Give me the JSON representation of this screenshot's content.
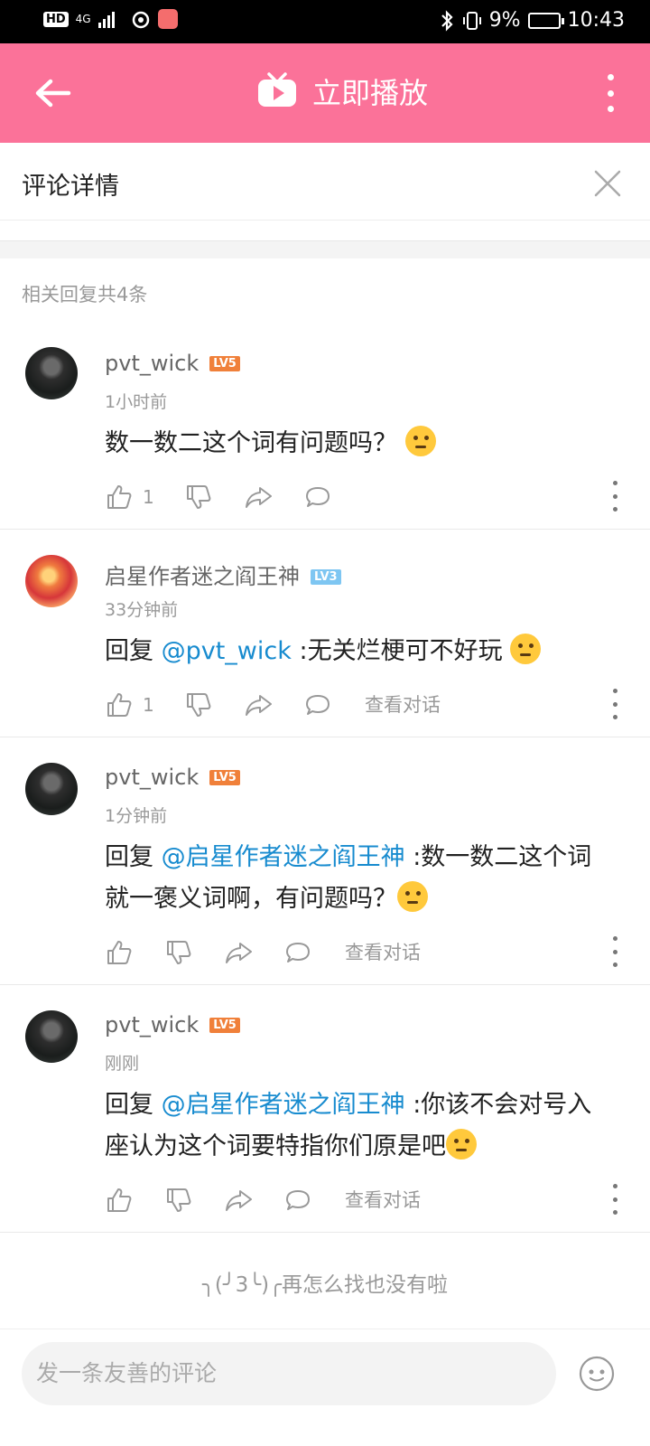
{
  "status_bar": {
    "hd": "HD",
    "network": "4G",
    "battery_pct": "9%",
    "time": "10:43"
  },
  "topbar": {
    "title": "立即播放"
  },
  "detail": {
    "title": "评论详情"
  },
  "reply_count": "相关回复共4条",
  "comments": [
    {
      "user": "pvt_wick",
      "level": "LV5",
      "time": "1小时前",
      "text": "数一数二这个词有问题吗？",
      "likes": "1",
      "view_conversation": ""
    },
    {
      "user": "启星作者迷之阎王神",
      "level": "LV3",
      "time": "33分钟前",
      "reply_prefix": "回复",
      "mention": "@pvt_wick",
      "text": ":无关烂梗可不好玩",
      "likes": "1",
      "view_conversation": "查看对话"
    },
    {
      "user": "pvt_wick",
      "level": "LV5",
      "time": "1分钟前",
      "reply_prefix": "回复",
      "mention": "@启星作者迷之阎王神",
      "text": ":数一数二这个词就一褒义词啊，有问题吗？",
      "likes": "",
      "view_conversation": "查看对话"
    },
    {
      "user": "pvt_wick",
      "level": "LV5",
      "time": "刚刚",
      "reply_prefix": "回复",
      "mention": "@启星作者迷之阎王神",
      "text": ":你该不会对号入座认为这个词要特指你们原是吧",
      "likes": "",
      "view_conversation": "查看对话"
    }
  ],
  "end_text": "╮(╯3╰)╭再怎么找也没有啦",
  "composer": {
    "placeholder": "发一条友善的评论"
  },
  "colors": {
    "accent_pink": "#fb7299",
    "mention_blue": "#178bcf",
    "lv5": "#f0803a",
    "lv3": "#7ec6f2"
  },
  "icons": [
    "back-arrow-icon",
    "tv-play-icon",
    "more-vertical-icon",
    "close-icon",
    "thumbs-up-icon",
    "thumbs-down-icon",
    "share-icon",
    "reply-bubble-icon",
    "emoji-face-icon"
  ]
}
